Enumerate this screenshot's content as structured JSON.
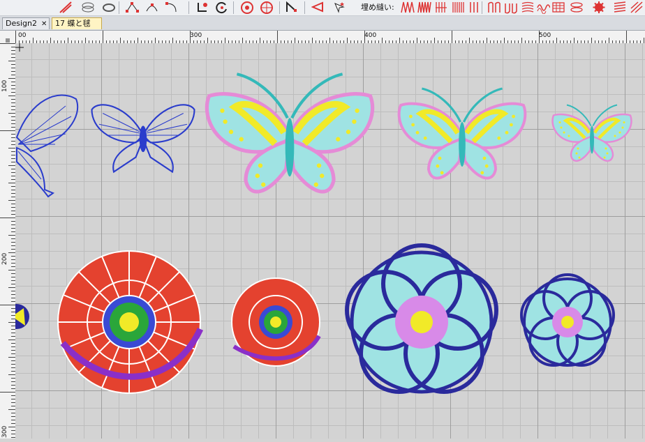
{
  "toolbar": {
    "fill_label": "埋め縫い:",
    "icons": [
      "line-tool-icon",
      "oval-stack-icon",
      "ring-icon",
      "node-edit-icon",
      "curve-node-icon",
      "arc-node-icon",
      "corner-icon",
      "rotate-icon",
      "compass-icon",
      "pie-icon",
      "node-arrow-icon",
      "triangle-arrow-icon",
      "select-star-icon",
      "zigzag-fill-icon",
      "zigzag-dense-icon",
      "straight-fill-icon",
      "wave-fill-icon",
      "spiral-fill-icon",
      "grid-fill-icon",
      "loop-fill-icon",
      "gear-fill-icon",
      "stripe-fill-icon"
    ]
  },
  "tabs": [
    {
      "label": "Design2",
      "close": "✕",
      "active": false
    },
    {
      "label": "17 蝶と毬",
      "close": "✕",
      "active": true
    }
  ],
  "rulers": {
    "top": [
      "00",
      "300",
      "400",
      "500"
    ],
    "left": [
      "100",
      "200",
      "300"
    ]
  },
  "colors": {
    "canvas": "#d3d3d3",
    "blue_outline": "#2a3ccc",
    "teal": "#34b9b9",
    "pink": "#e58bd6",
    "yellow": "#f1ea28",
    "red": "#e4422f",
    "purple": "#8a2fc8",
    "navy": "#2a2a9c"
  },
  "objects": [
    "butterfly-outline-partial",
    "butterfly-outline-small",
    "butterfly-embroidered-large",
    "butterfly-embroidered-medium",
    "butterfly-embroidered-small",
    "temari-ball-partial",
    "temari-ball-large",
    "temari-ball-medium",
    "temari-ball-navy-large",
    "temari-ball-navy-small"
  ]
}
